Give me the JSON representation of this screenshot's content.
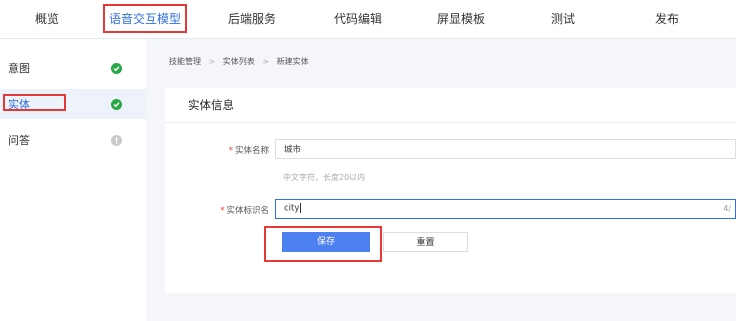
{
  "top_tabs": [
    {
      "label": "概览"
    },
    {
      "label": "语音交互模型"
    },
    {
      "label": "后端服务"
    },
    {
      "label": "代码编辑"
    },
    {
      "label": "屏显模板"
    },
    {
      "label": "测试"
    },
    {
      "label": "发布"
    }
  ],
  "sidebar": {
    "items": [
      {
        "label": "意图",
        "status": "complete"
      },
      {
        "label": "实体",
        "status": "complete"
      },
      {
        "label": "问答",
        "status": "incomplete"
      }
    ]
  },
  "breadcrumb": [
    "技能管理",
    "实体列表",
    "新建实体"
  ],
  "breadcrumb_separator": ">",
  "section_title": "实体信息",
  "form": {
    "required_mark": "*",
    "name_label": "实体名称",
    "name_value": "城市",
    "name_hint": "中文字符，长度20以内",
    "id_label": "实体标识名",
    "id_value": "city",
    "id_counter": "4/"
  },
  "buttons": {
    "save": "保存",
    "reset": "重置"
  },
  "colors": {
    "accent": "#2f6fe0",
    "primary_button": "#4c7ff0",
    "annotation_red": "#e53935",
    "status_green": "#28a745"
  }
}
